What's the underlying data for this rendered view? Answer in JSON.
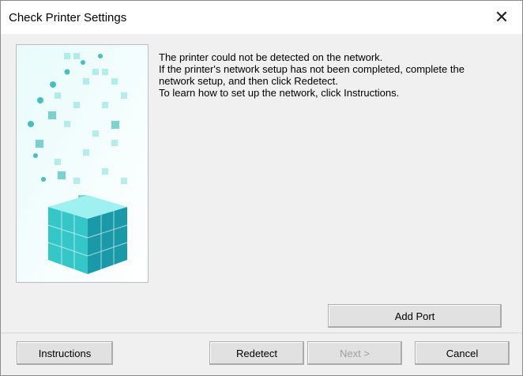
{
  "window": {
    "title": "Check Printer Settings",
    "close_symbol": "✕"
  },
  "message": {
    "lines": [
      "The printer could not be detected on the network.",
      "If the printer's network setup has not been completed, complete the",
      "network setup, and then click Redetect.",
      "To learn how to set up the network, click Instructions."
    ]
  },
  "buttons": {
    "add_port": "Add Port",
    "instructions": "Instructions",
    "redetect": "Redetect",
    "next": "Next >",
    "cancel": "Cancel"
  },
  "icons": {
    "close": "close-icon",
    "illustration": "printer-cubes-illustration"
  },
  "colors": {
    "accent_teal": "#2bb5b5",
    "cube_light": "#7fe0e0",
    "cube_dark": "#1a9aa8"
  }
}
